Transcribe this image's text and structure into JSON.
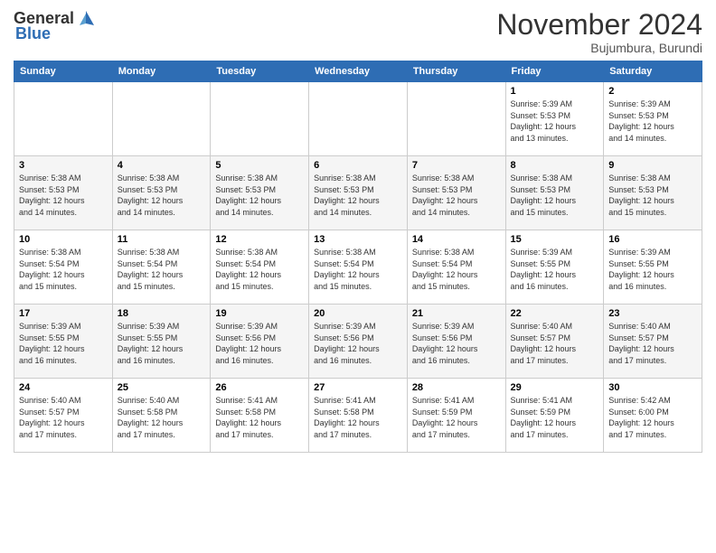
{
  "logo": {
    "general": "General",
    "blue": "Blue"
  },
  "header": {
    "month": "November 2024",
    "location": "Bujumbura, Burundi"
  },
  "weekdays": [
    "Sunday",
    "Monday",
    "Tuesday",
    "Wednesday",
    "Thursday",
    "Friday",
    "Saturday"
  ],
  "weeks": [
    [
      {
        "day": "",
        "info": ""
      },
      {
        "day": "",
        "info": ""
      },
      {
        "day": "",
        "info": ""
      },
      {
        "day": "",
        "info": ""
      },
      {
        "day": "",
        "info": ""
      },
      {
        "day": "1",
        "info": "Sunrise: 5:39 AM\nSunset: 5:53 PM\nDaylight: 12 hours\nand 13 minutes."
      },
      {
        "day": "2",
        "info": "Sunrise: 5:39 AM\nSunset: 5:53 PM\nDaylight: 12 hours\nand 14 minutes."
      }
    ],
    [
      {
        "day": "3",
        "info": "Sunrise: 5:38 AM\nSunset: 5:53 PM\nDaylight: 12 hours\nand 14 minutes."
      },
      {
        "day": "4",
        "info": "Sunrise: 5:38 AM\nSunset: 5:53 PM\nDaylight: 12 hours\nand 14 minutes."
      },
      {
        "day": "5",
        "info": "Sunrise: 5:38 AM\nSunset: 5:53 PM\nDaylight: 12 hours\nand 14 minutes."
      },
      {
        "day": "6",
        "info": "Sunrise: 5:38 AM\nSunset: 5:53 PM\nDaylight: 12 hours\nand 14 minutes."
      },
      {
        "day": "7",
        "info": "Sunrise: 5:38 AM\nSunset: 5:53 PM\nDaylight: 12 hours\nand 14 minutes."
      },
      {
        "day": "8",
        "info": "Sunrise: 5:38 AM\nSunset: 5:53 PM\nDaylight: 12 hours\nand 15 minutes."
      },
      {
        "day": "9",
        "info": "Sunrise: 5:38 AM\nSunset: 5:53 PM\nDaylight: 12 hours\nand 15 minutes."
      }
    ],
    [
      {
        "day": "10",
        "info": "Sunrise: 5:38 AM\nSunset: 5:54 PM\nDaylight: 12 hours\nand 15 minutes."
      },
      {
        "day": "11",
        "info": "Sunrise: 5:38 AM\nSunset: 5:54 PM\nDaylight: 12 hours\nand 15 minutes."
      },
      {
        "day": "12",
        "info": "Sunrise: 5:38 AM\nSunset: 5:54 PM\nDaylight: 12 hours\nand 15 minutes."
      },
      {
        "day": "13",
        "info": "Sunrise: 5:38 AM\nSunset: 5:54 PM\nDaylight: 12 hours\nand 15 minutes."
      },
      {
        "day": "14",
        "info": "Sunrise: 5:38 AM\nSunset: 5:54 PM\nDaylight: 12 hours\nand 15 minutes."
      },
      {
        "day": "15",
        "info": "Sunrise: 5:39 AM\nSunset: 5:55 PM\nDaylight: 12 hours\nand 16 minutes."
      },
      {
        "day": "16",
        "info": "Sunrise: 5:39 AM\nSunset: 5:55 PM\nDaylight: 12 hours\nand 16 minutes."
      }
    ],
    [
      {
        "day": "17",
        "info": "Sunrise: 5:39 AM\nSunset: 5:55 PM\nDaylight: 12 hours\nand 16 minutes."
      },
      {
        "day": "18",
        "info": "Sunrise: 5:39 AM\nSunset: 5:55 PM\nDaylight: 12 hours\nand 16 minutes."
      },
      {
        "day": "19",
        "info": "Sunrise: 5:39 AM\nSunset: 5:56 PM\nDaylight: 12 hours\nand 16 minutes."
      },
      {
        "day": "20",
        "info": "Sunrise: 5:39 AM\nSunset: 5:56 PM\nDaylight: 12 hours\nand 16 minutes."
      },
      {
        "day": "21",
        "info": "Sunrise: 5:39 AM\nSunset: 5:56 PM\nDaylight: 12 hours\nand 16 minutes."
      },
      {
        "day": "22",
        "info": "Sunrise: 5:40 AM\nSunset: 5:57 PM\nDaylight: 12 hours\nand 17 minutes."
      },
      {
        "day": "23",
        "info": "Sunrise: 5:40 AM\nSunset: 5:57 PM\nDaylight: 12 hours\nand 17 minutes."
      }
    ],
    [
      {
        "day": "24",
        "info": "Sunrise: 5:40 AM\nSunset: 5:57 PM\nDaylight: 12 hours\nand 17 minutes."
      },
      {
        "day": "25",
        "info": "Sunrise: 5:40 AM\nSunset: 5:58 PM\nDaylight: 12 hours\nand 17 minutes."
      },
      {
        "day": "26",
        "info": "Sunrise: 5:41 AM\nSunset: 5:58 PM\nDaylight: 12 hours\nand 17 minutes."
      },
      {
        "day": "27",
        "info": "Sunrise: 5:41 AM\nSunset: 5:58 PM\nDaylight: 12 hours\nand 17 minutes."
      },
      {
        "day": "28",
        "info": "Sunrise: 5:41 AM\nSunset: 5:59 PM\nDaylight: 12 hours\nand 17 minutes."
      },
      {
        "day": "29",
        "info": "Sunrise: 5:41 AM\nSunset: 5:59 PM\nDaylight: 12 hours\nand 17 minutes."
      },
      {
        "day": "30",
        "info": "Sunrise: 5:42 AM\nSunset: 6:00 PM\nDaylight: 12 hours\nand 17 minutes."
      }
    ]
  ]
}
